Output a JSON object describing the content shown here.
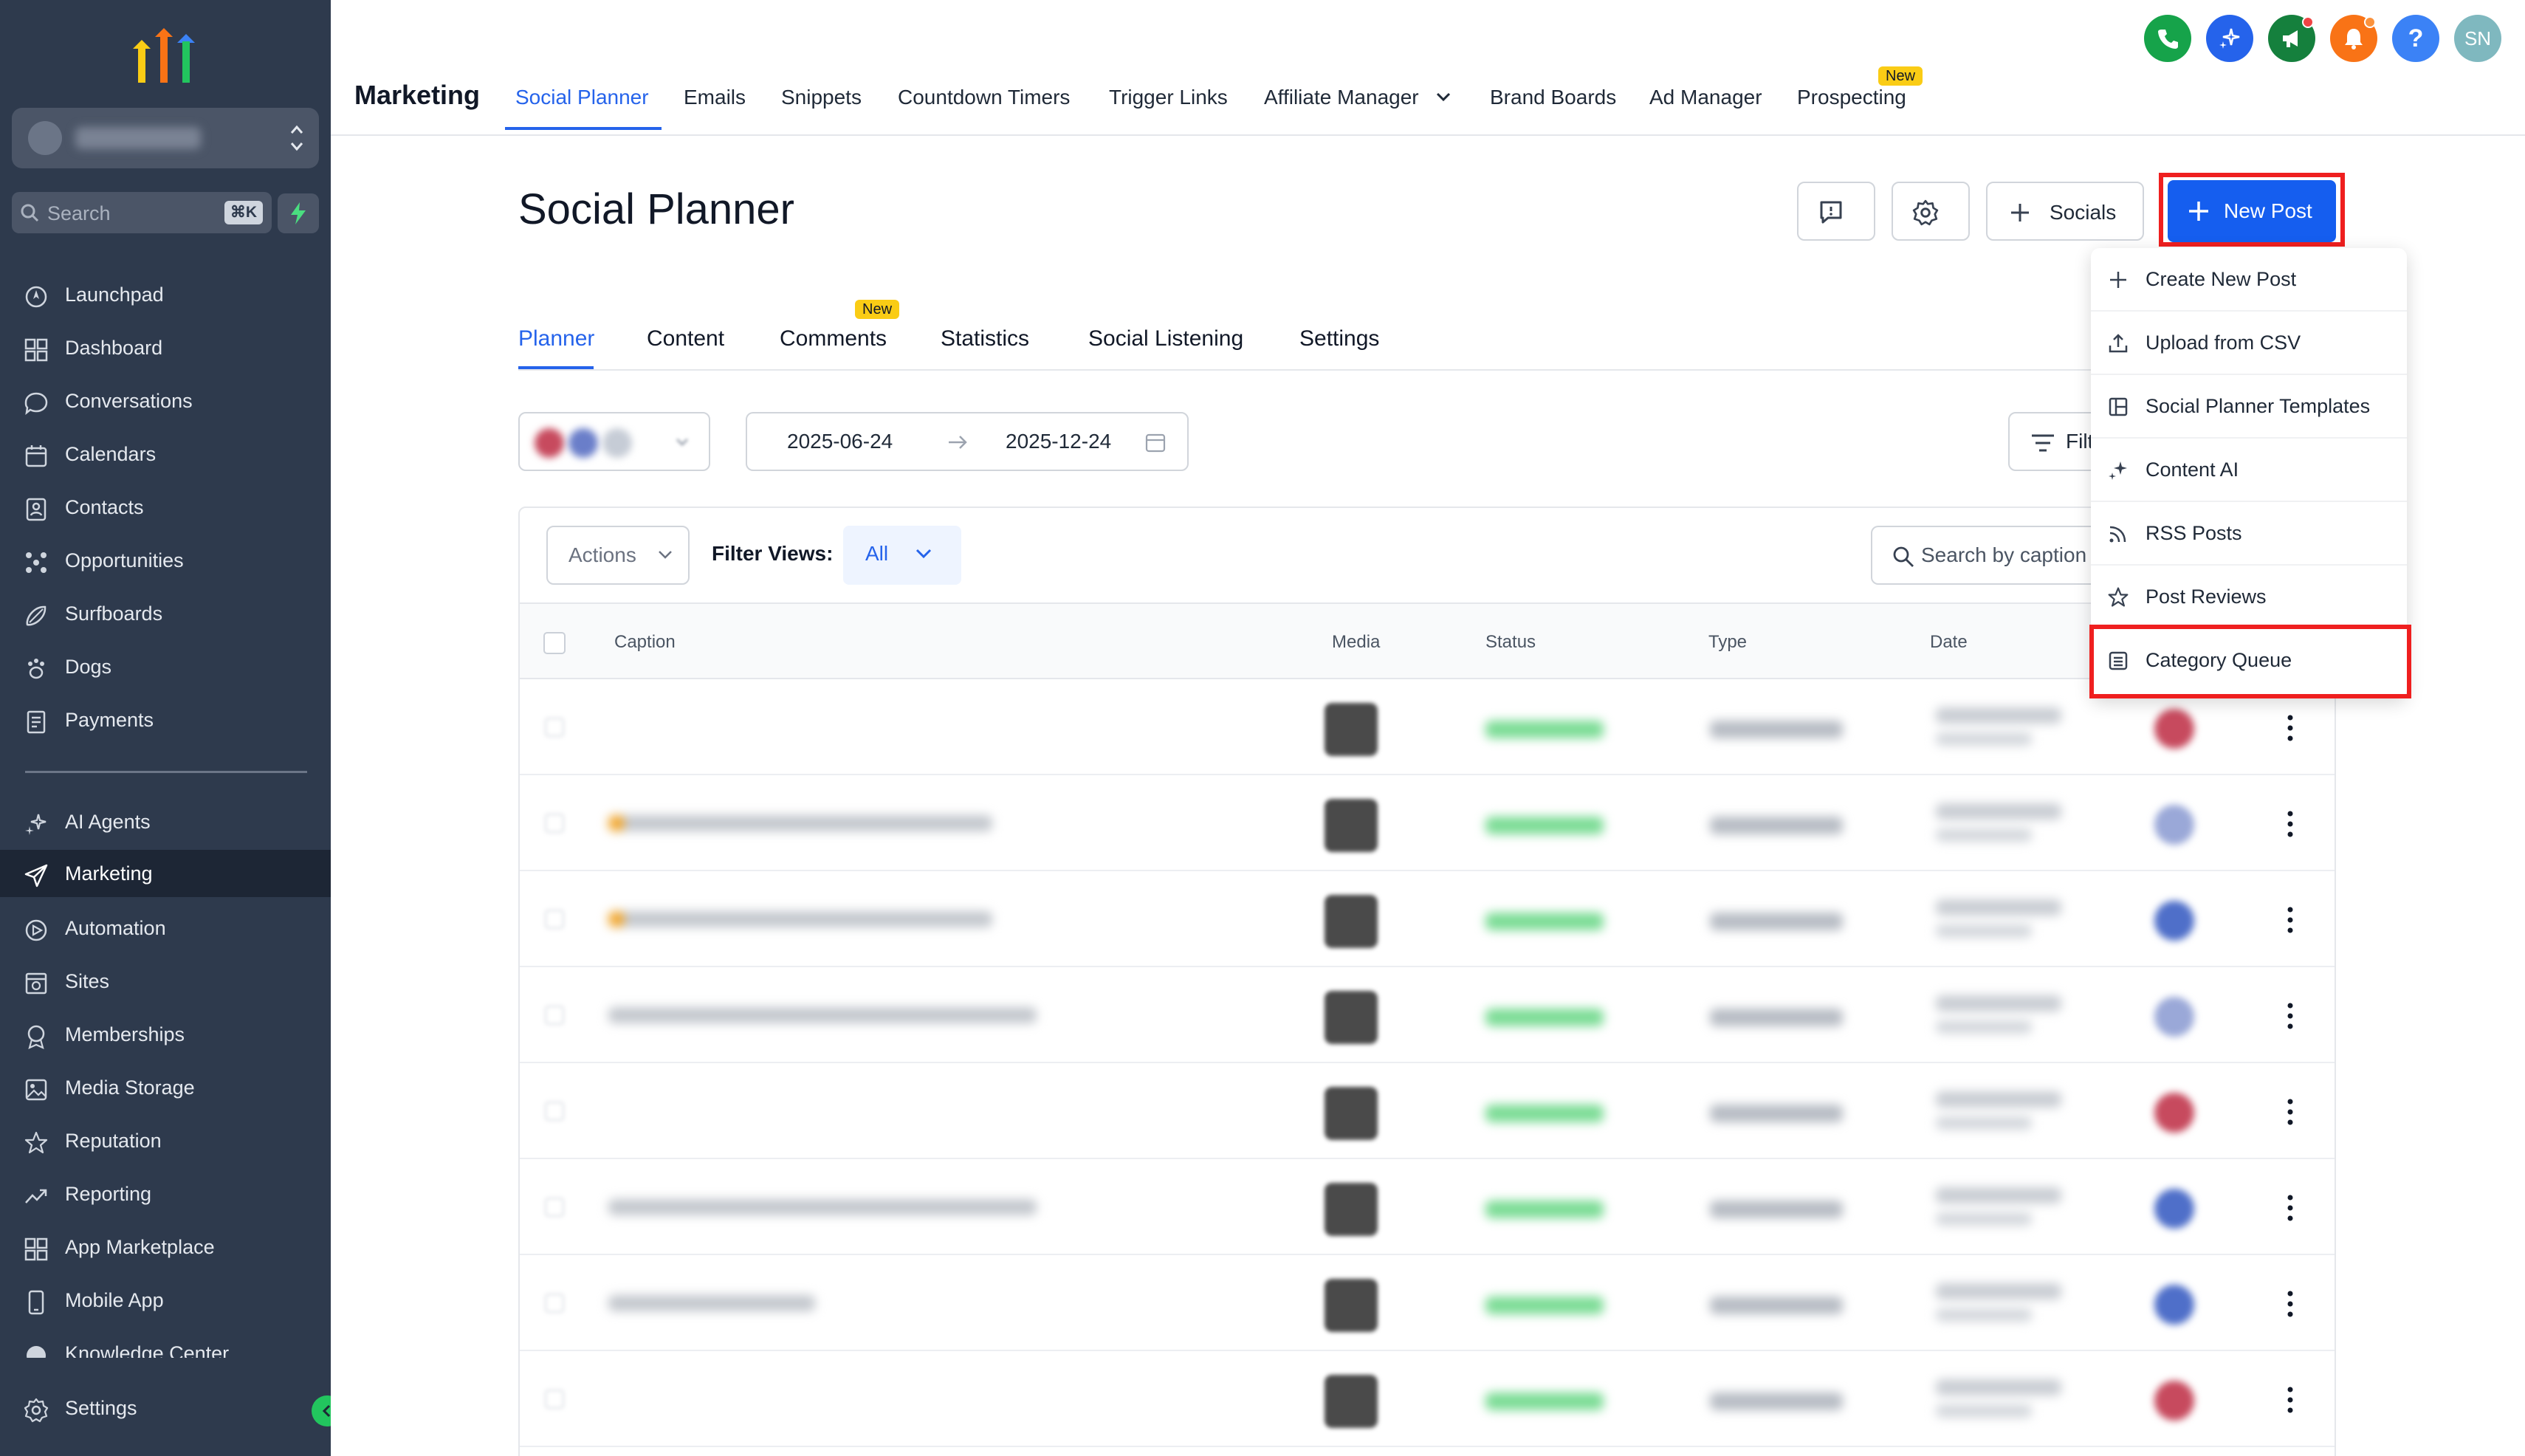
{
  "sidebar": {
    "search_label": "Search",
    "search_shortcut": "⌘K",
    "items": [
      {
        "label": "Launchpad",
        "icon": "launchpad-icon"
      },
      {
        "label": "Dashboard",
        "icon": "dashboard-icon"
      },
      {
        "label": "Conversations",
        "icon": "chat-bubble-icon"
      },
      {
        "label": "Calendars",
        "icon": "calendar-icon"
      },
      {
        "label": "Contacts",
        "icon": "contacts-icon"
      },
      {
        "label": "Opportunities",
        "icon": "opportunities-icon"
      },
      {
        "label": "Surfboards",
        "icon": "surfboard-icon"
      },
      {
        "label": "Dogs",
        "icon": "paw-icon"
      },
      {
        "label": "Payments",
        "icon": "receipt-icon"
      }
    ],
    "items_lower": [
      {
        "label": "AI Agents",
        "icon": "sparkles-icon"
      },
      {
        "label": "Marketing",
        "icon": "paper-plane-icon",
        "active": true
      },
      {
        "label": "Automation",
        "icon": "automation-icon"
      },
      {
        "label": "Sites",
        "icon": "sites-icon"
      },
      {
        "label": "Memberships",
        "icon": "membership-icon"
      },
      {
        "label": "Media Storage",
        "icon": "image-icon"
      },
      {
        "label": "Reputation",
        "icon": "star-icon"
      },
      {
        "label": "Reporting",
        "icon": "trend-icon"
      },
      {
        "label": "App Marketplace",
        "icon": "grid-icon"
      },
      {
        "label": "Mobile App",
        "icon": "mobile-icon"
      },
      {
        "label": "Knowledge Center",
        "icon": "knowledge-icon"
      }
    ],
    "settings_label": "Settings"
  },
  "topbar": {
    "section_title": "Marketing",
    "tabs": [
      {
        "label": "Social Planner",
        "active": true
      },
      {
        "label": "Emails"
      },
      {
        "label": "Snippets"
      },
      {
        "label": "Countdown Timers"
      },
      {
        "label": "Trigger Links"
      },
      {
        "label": "Affiliate Manager"
      },
      {
        "label": "Brand Boards"
      },
      {
        "label": "Ad Manager"
      },
      {
        "label": "Prospecting"
      }
    ],
    "prospecting_badge": "New",
    "avatar_initials": "SN",
    "help_glyph": "?"
  },
  "page": {
    "title": "Social Planner",
    "socials_label": "Socials",
    "new_post_label": "New Post",
    "subtabs": [
      {
        "label": "Planner",
        "active": true
      },
      {
        "label": "Content"
      },
      {
        "label": "Comments"
      },
      {
        "label": "Statistics"
      },
      {
        "label": "Social Listening"
      },
      {
        "label": "Settings"
      }
    ],
    "comments_badge": "New",
    "date_start": "2025-06-24",
    "date_end": "2025-12-24",
    "filters_label": "Filt"
  },
  "table": {
    "actions_label": "Actions",
    "filter_views_label": "Filter Views:",
    "filter_views_value": "All",
    "search_placeholder": "Search by caption",
    "columns": [
      "Caption",
      "Media",
      "Status",
      "Type",
      "Date"
    ]
  },
  "menu": {
    "items": [
      {
        "label": "Create New Post",
        "icon": "plus-icon"
      },
      {
        "label": "Upload from CSV",
        "icon": "upload-icon"
      },
      {
        "label": "Social Planner Templates",
        "icon": "template-icon"
      },
      {
        "label": "Content AI",
        "icon": "sparkles-icon"
      },
      {
        "label": "RSS Posts",
        "icon": "rss-icon"
      },
      {
        "label": "Post Reviews",
        "icon": "star-icon"
      },
      {
        "label": "Category Queue",
        "icon": "queue-icon"
      }
    ]
  },
  "colors": {
    "sidebar_bg": "#2e3a4d",
    "accent_blue": "#155eef",
    "highlight_red": "#ef1f1f",
    "badge_yellow": "#facc15"
  }
}
